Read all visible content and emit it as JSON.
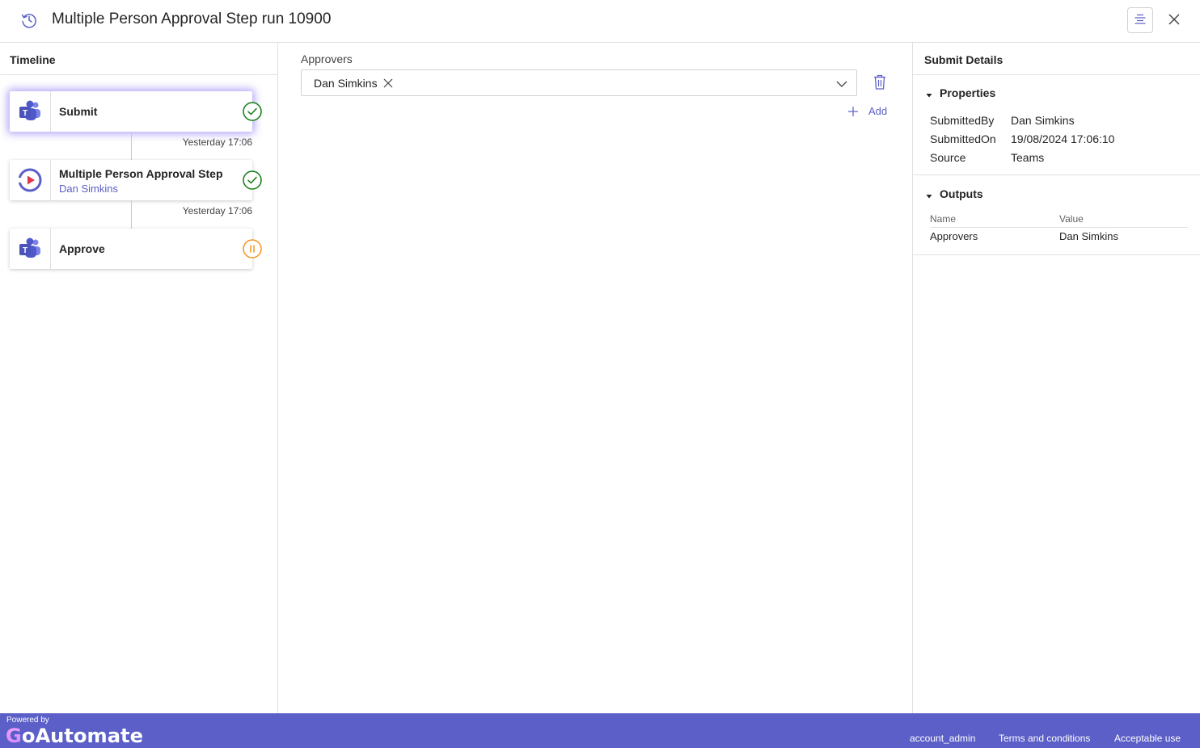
{
  "header": {
    "title": "Multiple Person Approval Step run 10900",
    "icons": {
      "history": "history-icon",
      "toggle": "align-center-icon",
      "close": "close-icon"
    }
  },
  "timeline": {
    "title": "Timeline",
    "steps": [
      {
        "label": "Submit",
        "subtitle": "",
        "icon": "teams-icon",
        "status": "completed",
        "timestamp": "Yesterday 17:06"
      },
      {
        "label": "Multiple Person Approval Step",
        "subtitle": "Dan Simkins",
        "icon": "goautomate-play-icon",
        "status": "completed",
        "timestamp": "Yesterday 17:06"
      },
      {
        "label": "Approve",
        "subtitle": "",
        "icon": "teams-icon",
        "status": "paused",
        "timestamp": ""
      }
    ]
  },
  "approvers": {
    "label": "Approvers",
    "selected": [
      "Dan Simkins"
    ],
    "add_label": "Add"
  },
  "details": {
    "title": "Submit Details",
    "properties_label": "Properties",
    "properties": [
      {
        "key": "SubmittedBy",
        "value": "Dan Simkins"
      },
      {
        "key": "SubmittedOn",
        "value": "19/08/2024 17:06:10"
      },
      {
        "key": "Source",
        "value": "Teams"
      }
    ],
    "outputs_label": "Outputs",
    "outputs_columns": [
      "Name",
      "Value"
    ],
    "outputs": [
      {
        "name": "Approvers",
        "value": "Dan Simkins"
      }
    ]
  },
  "footer": {
    "powered_by": "Powered by",
    "brand": "GoAutomate",
    "links": [
      "account_admin",
      "Terms and conditions",
      "Acceptable use"
    ]
  },
  "colors": {
    "accent": "#5b5fc7",
    "success": "#107c10",
    "paused": "#f7931e",
    "footer_bg": "#5b5fc7"
  }
}
